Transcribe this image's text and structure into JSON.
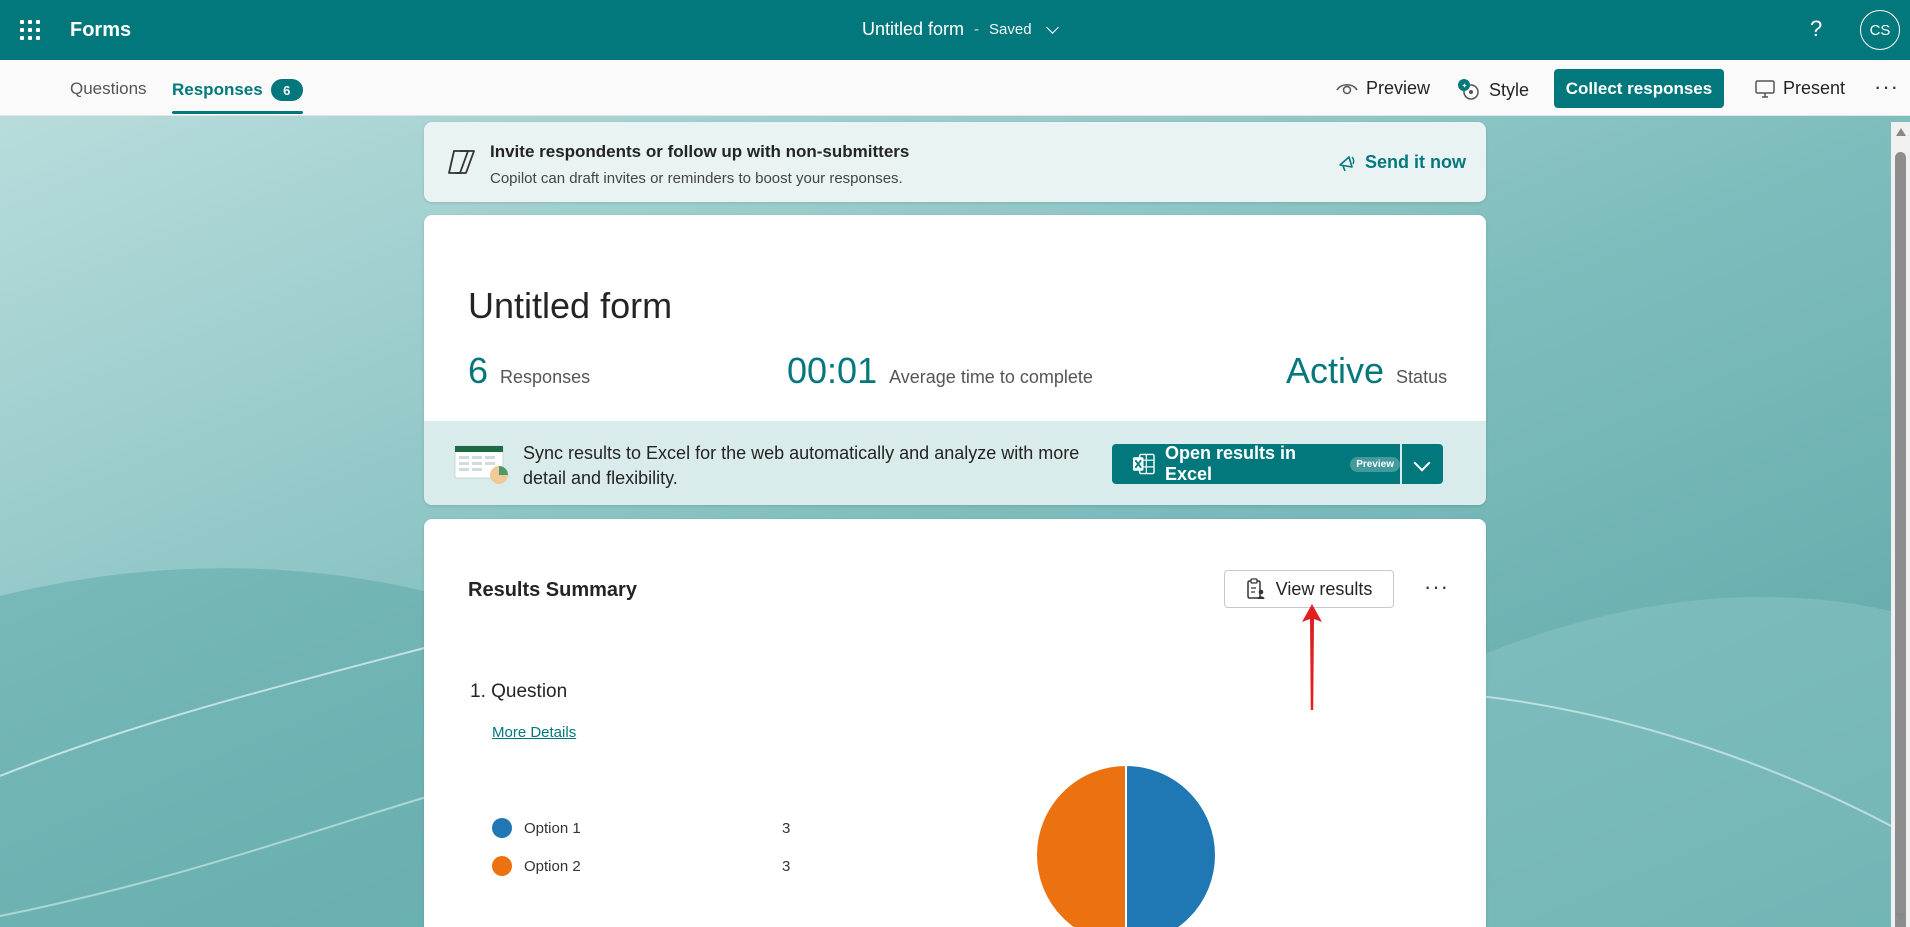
{
  "topbar": {
    "app_name": "Forms",
    "form_title": "Untitled form",
    "separator": "-",
    "save_status": "Saved",
    "help": "?",
    "avatar_initials": "CS"
  },
  "tabs": {
    "questions": "Questions",
    "responses": "Responses",
    "responses_count": "6"
  },
  "actions": {
    "preview": "Preview",
    "style": "Style",
    "collect": "Collect responses",
    "present": "Present",
    "more": "···"
  },
  "copilot": {
    "heading": "Invite respondents or follow up with non-submitters",
    "subtext": "Copilot can draft invites or reminders to boost your responses.",
    "action": "Send it now"
  },
  "summary": {
    "title": "Untitled form",
    "responses_num": "6",
    "responses_label": "Responses",
    "avg_time": "00:01",
    "avg_time_label": "Average time to complete",
    "status_value": "Active",
    "status_label": "Status"
  },
  "excel": {
    "text": "Sync results to Excel for the web automatically and analyze with more detail and flexibility.",
    "button": "Open results in Excel",
    "pill": "Preview"
  },
  "results": {
    "title": "Results Summary",
    "view_button": "View results",
    "more": "···",
    "question": "1.  Question",
    "more_details": "More Details",
    "options": [
      {
        "label": "Option 1",
        "count": "3",
        "color": "#1f77b4"
      },
      {
        "label": "Option 2",
        "count": "3",
        "color": "#ec7110"
      }
    ]
  },
  "colors": {
    "brand": "#03787c",
    "annotation": "#e02020"
  }
}
